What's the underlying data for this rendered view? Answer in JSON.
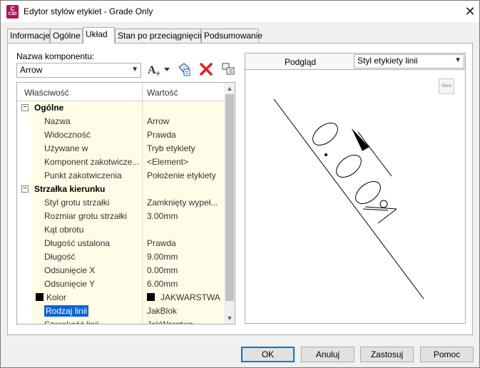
{
  "window": {
    "title": "Edytor stylów etykiet - Grade Only",
    "app_icon_text": "C",
    "app_icon_sub": "C3D"
  },
  "tabs": [
    "Informacje",
    "Ogólne",
    "Układ",
    "Stan po przeciągnięciu",
    "Podsumowanie"
  ],
  "component": {
    "label": "Nazwa komponentu:",
    "value": "Arrow"
  },
  "grid": {
    "col_property": "Właściwość",
    "col_value": "Wartość",
    "rows": [
      {
        "type": "cat",
        "name": "Ogólne",
        "value": ""
      },
      {
        "type": "prop",
        "name": "Nazwa",
        "value": "Arrow"
      },
      {
        "type": "prop",
        "name": "Widoczność",
        "value": "Prawda"
      },
      {
        "type": "prop",
        "name": "Używane w",
        "value": "Tryb etykiety"
      },
      {
        "type": "prop",
        "name": "Komponent zakotwicze...",
        "value": "<Element>"
      },
      {
        "type": "prop",
        "name": "Punkt zakotwiczenia",
        "value": "Położenie etykiety"
      },
      {
        "type": "cat",
        "name": "Strzałka kierunku",
        "value": ""
      },
      {
        "type": "prop",
        "name": "Styl grotu strzałki",
        "value": "Zamknięty wypeł..."
      },
      {
        "type": "prop",
        "name": "Rozmiar grotu strzałki",
        "value": "3.00mm"
      },
      {
        "type": "prop",
        "name": "Kąt obrotu",
        "value": ""
      },
      {
        "type": "prop",
        "name": "Długość ustalona",
        "value": "Prawda"
      },
      {
        "type": "prop",
        "name": "Długość",
        "value": "9.00mm"
      },
      {
        "type": "prop",
        "name": "Odsunięcie X",
        "value": "0.00mm"
      },
      {
        "type": "prop",
        "name": "Odsunięcie Y",
        "value": "6.00mm"
      },
      {
        "type": "color",
        "name": "Kolor",
        "value": "JAKWARSTWA"
      },
      {
        "type": "sel",
        "name": "Rodzaj linii",
        "value": "JakBlok"
      },
      {
        "type": "prop",
        "name": "Szerokość linii",
        "value": "JakWarstwa"
      }
    ]
  },
  "preview": {
    "label": "Podgląd",
    "style_value": "Styl etykiety linii",
    "view_button": "Góra"
  },
  "buttons": {
    "ok": "OK",
    "cancel": "Anuluj",
    "apply": "Zastosuj",
    "help": "Pomoc"
  },
  "colors": {
    "accent": "#0078d7",
    "selection": "#0a64d8",
    "grid_fill": "#fffde7",
    "delete_red": "#e02020"
  }
}
